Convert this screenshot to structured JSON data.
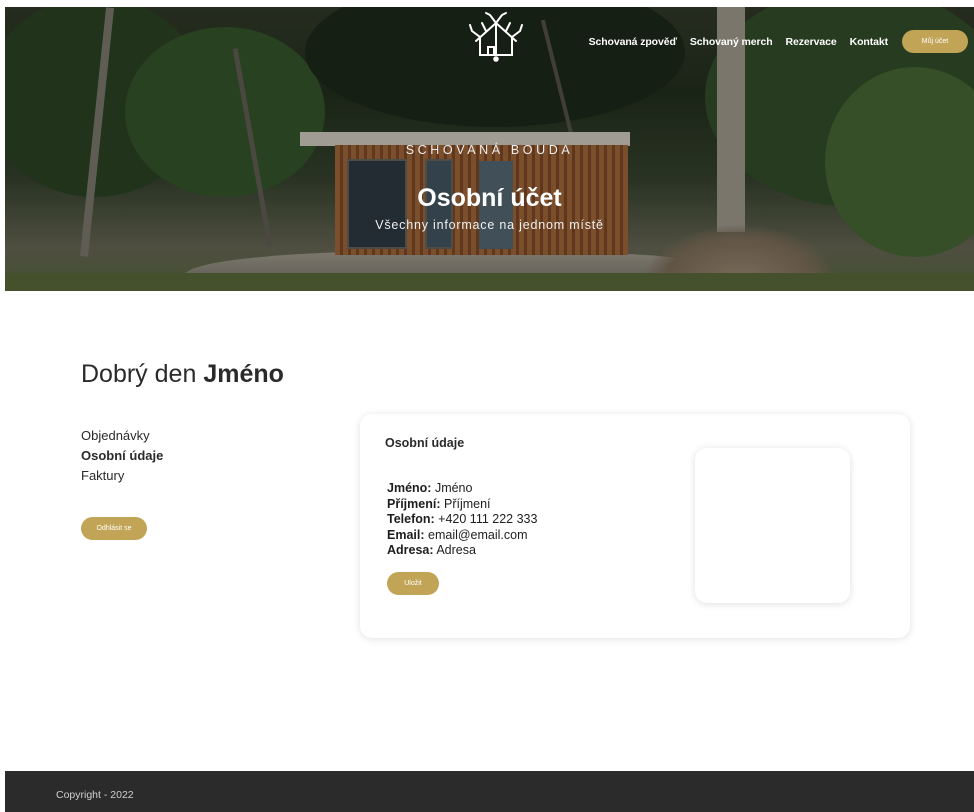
{
  "nav": {
    "links": [
      "Schovaná zpověď",
      "Schovaný merch",
      "Rezervace",
      "Kontakt"
    ],
    "account_button": "Můj účet"
  },
  "hero": {
    "subtitle": "SCHOVANÁ BOUDA",
    "title": "Osobní účet",
    "tagline": "Všechny informace na jednom místě"
  },
  "greeting": {
    "prefix": "Dobrý den",
    "name": "Jméno"
  },
  "sidebar": {
    "items": [
      {
        "label": "Objednávky",
        "active": false
      },
      {
        "label": "Osobní údaje",
        "active": true
      },
      {
        "label": "Faktury",
        "active": false
      }
    ],
    "logout_button": "Odhlásit se"
  },
  "card": {
    "title": "Osobní údaje",
    "fields": [
      {
        "label": "Jméno:",
        "value": "Jméno"
      },
      {
        "label": "Příjmení:",
        "value": "Příjmení"
      },
      {
        "label": "Telefon:",
        "value": "+420 111 222 333"
      },
      {
        "label": "Email:",
        "value": "email@email.com"
      },
      {
        "label": "Adresa:",
        "value": "Adresa"
      }
    ],
    "save_button": "Uložit"
  },
  "footer": {
    "copyright": "Copyright - 2022"
  },
  "colors": {
    "accent": "#c2a457",
    "footer_bg": "#2b2b2b"
  },
  "icons": {
    "logo": "tree-house-logo"
  }
}
